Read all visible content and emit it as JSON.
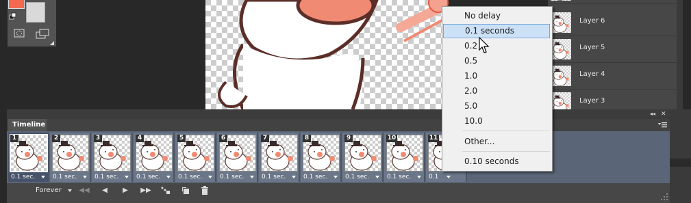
{
  "timeline": {
    "title": "Timeline",
    "frames": [
      {
        "number": "1",
        "delay": "0.1 sec.",
        "selected": true
      },
      {
        "number": "2",
        "delay": "0.1 sec."
      },
      {
        "number": "3",
        "delay": "0.1 sec."
      },
      {
        "number": "4",
        "delay": "0.1 sec."
      },
      {
        "number": "5",
        "delay": "0.1 sec."
      },
      {
        "number": "6",
        "delay": "0.1 sec."
      },
      {
        "number": "7",
        "delay": "0.1 sec."
      },
      {
        "number": "8",
        "delay": "0.1 sec."
      },
      {
        "number": "9",
        "delay": "0.1 sec."
      },
      {
        "number": "10",
        "delay": "0.1 sec."
      },
      {
        "number": "11",
        "delay": "0.1"
      }
    ],
    "loop": "Forever",
    "controls": {
      "first": "◀◀",
      "prev": "◀",
      "play": "▶",
      "next": "▶▶"
    }
  },
  "layers": [
    "Layer 6",
    "Layer 5",
    "Layer 4",
    "Layer 3"
  ],
  "delay_menu": {
    "items": [
      "No delay",
      "0.1 seconds",
      "0.2",
      "0.5",
      "1.0",
      "2.0",
      "5.0",
      "10.0"
    ],
    "highlighted": "0.1 seconds",
    "other": "Other...",
    "current": "0.10 seconds"
  },
  "colors": {
    "foreground": "#f26b50",
    "background": "#d9d9d9",
    "menu_highlight": "#cde1f6"
  }
}
